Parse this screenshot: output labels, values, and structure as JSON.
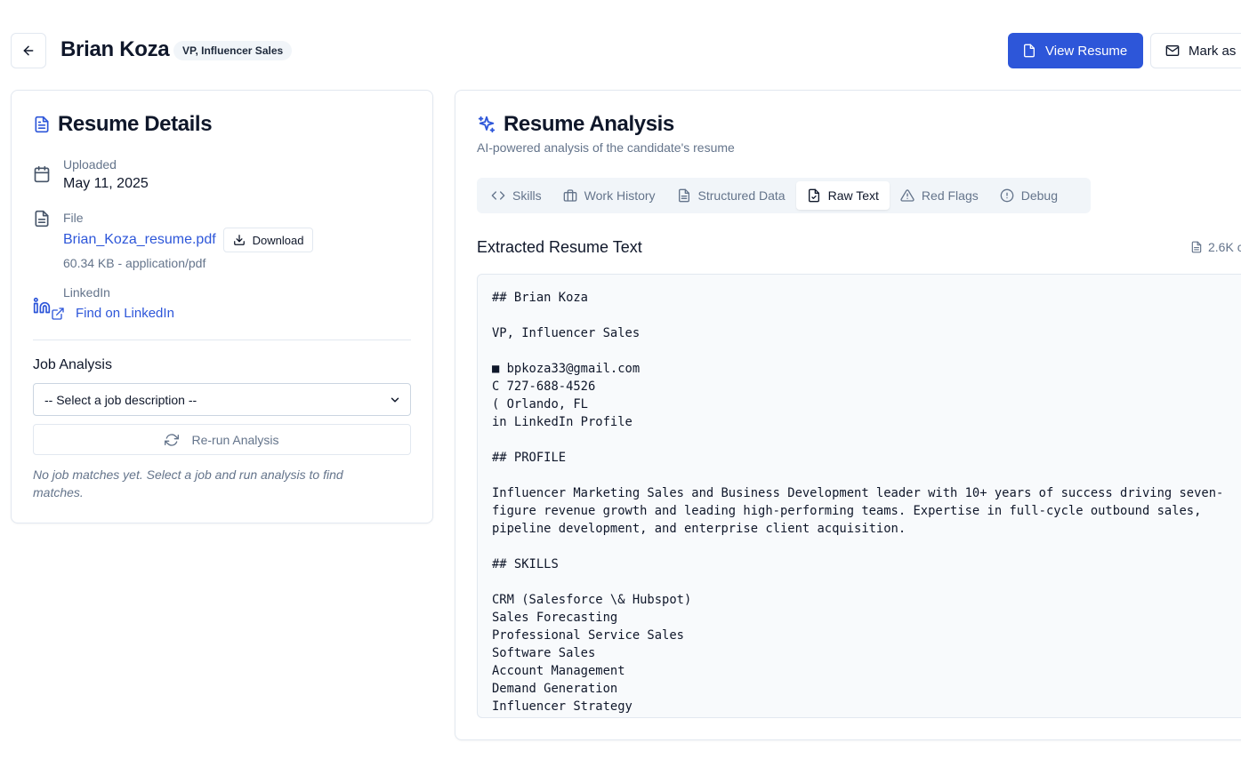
{
  "header": {
    "candidate_name": "Brian Koza",
    "title_badge": "VP, Influencer Sales",
    "view_resume_label": "View Resume",
    "mark_label": "Mark as"
  },
  "resume_details": {
    "heading": "Resume Details",
    "uploaded_label": "Uploaded",
    "uploaded_value": "May 11, 2025",
    "file_label": "File",
    "file_name": "Brian_Koza_resume.pdf",
    "download_label": "Download",
    "file_meta": "60.34 KB - application/pdf",
    "linkedin_label": "LinkedIn",
    "linkedin_link": "Find on LinkedIn",
    "job_analysis_title": "Job Analysis",
    "job_select_value": "-- Select a job description --",
    "rerun_label": "Re-run Analysis",
    "no_matches": "No job matches yet. Select a job and run analysis to find matches."
  },
  "analysis": {
    "heading": "Resume Analysis",
    "subtitle": "AI-powered analysis of the candidate's resume",
    "tabs": [
      {
        "label": "Skills",
        "icon": "code-icon"
      },
      {
        "label": "Work History",
        "icon": "briefcase-icon"
      },
      {
        "label": "Structured Data",
        "icon": "document-icon"
      },
      {
        "label": "Raw Text",
        "icon": "file-text-icon"
      },
      {
        "label": "Red Flags",
        "icon": "warning-icon"
      },
      {
        "label": "Debug",
        "icon": "info-circle-icon"
      }
    ],
    "active_tab": "Raw Text",
    "extract_title": "Extracted Resume Text",
    "char_count": "2.6K c",
    "raw_lines": [
      "## Brian Koza",
      "",
      "VP, Influencer Sales",
      "",
      "■ bpkoza33@gmail.com",
      "C 727-688-4526",
      "( Orlando, FL",
      "in LinkedIn Profile",
      "",
      "## PROFILE",
      "",
      "Influencer Marketing Sales and Business Development leader with 10+ years of success driving seven-",
      "figure revenue growth and leading high-performing teams. Expertise in full-cycle outbound sales,",
      "pipeline development, and enterprise client acquisition.",
      "",
      "## SKILLS",
      "",
      "CRM (Salesforce \\& Hubspot)",
      "Sales Forecasting",
      "Professional Service Sales",
      "Software Sales",
      "Account Management",
      "Demand Generation",
      "Influencer Strategy"
    ]
  },
  "colors": {
    "accent": "#2d56d9",
    "muted_text": "#64748b",
    "border": "#e2e8f0"
  }
}
